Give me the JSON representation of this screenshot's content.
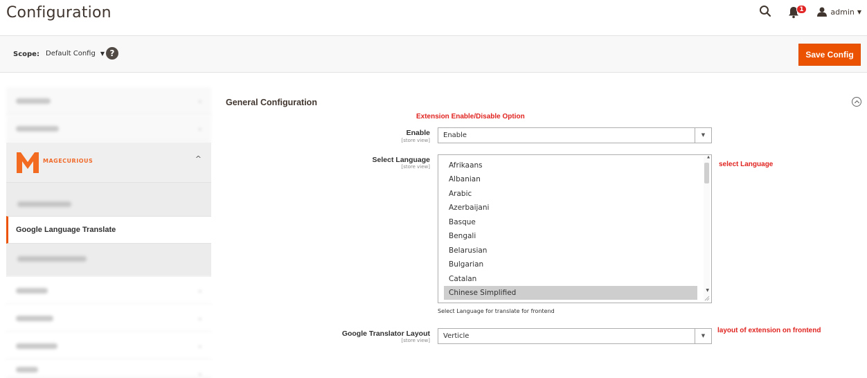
{
  "header": {
    "title": "Configuration",
    "notification_count": "1",
    "user_name": "admin"
  },
  "scope": {
    "label": "Scope:",
    "value": "Default Config",
    "help": "?"
  },
  "toolbar": {
    "save_label": "Save Config"
  },
  "sidebar": {
    "brand_name": "MAGECURIOUS",
    "active_item": "Google Language Translate"
  },
  "main": {
    "section_title": "General Configuration",
    "fields": {
      "enable": {
        "label": "Enable",
        "scope": "[store view]",
        "value": "Enable"
      },
      "language": {
        "label": "Select Language",
        "scope": "[store view]",
        "options": [
          "Afrikaans",
          "Albanian",
          "Arabic",
          "Azerbaijani",
          "Basque",
          "Bengali",
          "Belarusian",
          "Bulgarian",
          "Catalan",
          "Chinese Simplified"
        ],
        "selected": "Chinese Simplified",
        "hint": "Select Language for translate for frontend"
      },
      "layout": {
        "label": "Google Translator Layout",
        "scope": "[store view]",
        "value": "Verticle"
      }
    }
  },
  "annotations": {
    "enable": "Extension Enable/Disable Option",
    "language": "select Language",
    "layout": "layout of extension on frontend"
  },
  "colors": {
    "accent": "#eb5202",
    "annotation": "#e0231f",
    "selected_row": "#cecece"
  }
}
